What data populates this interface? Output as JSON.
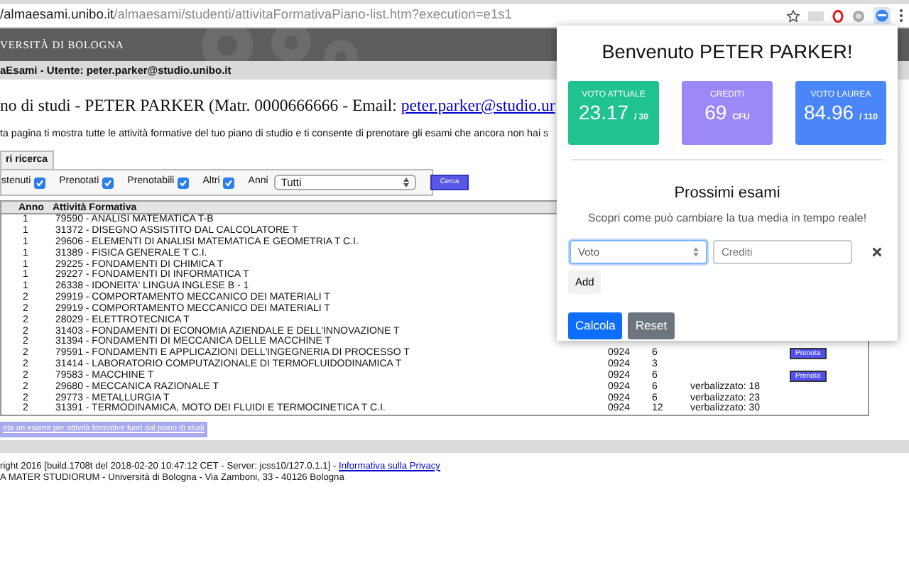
{
  "browser": {
    "url_host": "/almaesami.unibo.it",
    "url_path": "/almaesami/studenti/attivitaFormativaPiano-list.htm?execution=e1s1"
  },
  "banner": {
    "title": "VERSITÀ DI BOLOGNA"
  },
  "user_bar": "aEsami - Utente: peter.parker@studio.unibo.it",
  "heading": {
    "text": "no di studi - PETER PARKER (Matr. 0000666666 - Email: ",
    "link": "peter.parker@studio.ur"
  },
  "description": "ta pagina ti mostra tutte le attività formative del tuo piano di studio e ti consente di prenotare gli esami che ancora non hai s",
  "filter_tab": "ri ricerca",
  "filters": [
    {
      "label": "stenuti",
      "checked": true
    },
    {
      "label": "Prenotati",
      "checked": true
    },
    {
      "label": "Prenotabili",
      "checked": true
    },
    {
      "label": "Altri",
      "checked": true
    }
  ],
  "year_filter": {
    "label": "Anni",
    "value": "Tutti"
  },
  "search_button": "Cerca",
  "table": {
    "columns": [
      "Anno",
      "Attività Formativa"
    ],
    "rows": [
      {
        "anno": "1",
        "activity": "79590 - ANALISI MATEMATICA T-B"
      },
      {
        "anno": "1",
        "activity": "31372 - DISEGNO ASSISTITO DAL CALCOLATORE T"
      },
      {
        "anno": "1",
        "activity": "29606 - ELEMENTI DI ANALISI MATEMATICA E GEOMETRIA T C.I."
      },
      {
        "anno": "1",
        "activity": "31389 - FISICA GENERALE T C.I."
      },
      {
        "anno": "1",
        "activity": "29225 - FONDAMENTI DI CHIMICA T"
      },
      {
        "anno": "1",
        "activity": "29227 - FONDAMENTI DI INFORMATICA T"
      },
      {
        "anno": "1",
        "activity": "26338 - IDONEITA' LINGUA INGLESE B - 1"
      },
      {
        "anno": "2",
        "activity": "29919 - COMPORTAMENTO MECCANICO DEI MATERIALI T"
      },
      {
        "anno": "2",
        "activity": "29919 - COMPORTAMENTO MECCANICO DEI MATERIALI T"
      },
      {
        "anno": "2",
        "activity": "28029 - ELETTROTECNICA T"
      },
      {
        "anno": "2",
        "activity": "31403 - FONDAMENTI DI ECONOMIA AZIENDALE E DELL'INNOVAZIONE T"
      },
      {
        "anno": "2",
        "activity": "31394 - FONDAMENTI DI MECCANICA DELLE MACCHINE T"
      },
      {
        "anno": "2",
        "activity": "79591 - FONDAMENTI E APPLICAZIONI DELL'INGEGNERIA DI PROCESSO T",
        "code": "0924",
        "cfu": "6",
        "action": "Prenota"
      },
      {
        "anno": "2",
        "activity": "31414 - LABORATORIO COMPUTAZIONALE DI TERMOFLUIDODINAMICA T",
        "code": "0924",
        "cfu": "3"
      },
      {
        "anno": "2",
        "activity": "79583 - MACCHINE T",
        "code": "0924",
        "cfu": "6",
        "action": "Prenota"
      },
      {
        "anno": "2",
        "activity": "29680 - MECCANICA RAZIONALE T",
        "code": "0924",
        "cfu": "6",
        "note": "verbalizzato: 18"
      },
      {
        "anno": "2",
        "activity": "29773 - METALLURGIA T",
        "code": "0924",
        "cfu": "6",
        "note": "verbalizzato: 23"
      },
      {
        "anno": "2",
        "activity": "31391 - TERMODINAMICA, MOTO DEI FLUIDI E TERMOCINETICA T C.I.",
        "code": "0924",
        "cfu": "12",
        "note": "verbalizzato: 30"
      }
    ]
  },
  "outside_plan_link": "ota un esame per attività formative fuori dal piano di studi",
  "footer": {
    "line1": "right 2016 [build.1708t del 2018-02-20 10:47:12 CET - Server: jcss10/127.0.1.1] - ",
    "privacy_link": "Informativa sulla Privacy",
    "line2": "A MATER STUDIORUM - Università di Bologna - Via Zamboni, 33 - 40126 Bologna"
  },
  "popup": {
    "title": "Benvenuto PETER PARKER!",
    "stats": [
      {
        "label": "VOTO ATTUALE",
        "value": "23.17",
        "unit": "/ 30",
        "color": "#20c38f"
      },
      {
        "label": "CREDITI",
        "value": "69",
        "unit": "CFU",
        "color": "#9c88f7"
      },
      {
        "label": "VOTO LAUREA",
        "value": "84.96",
        "unit": "/ 110",
        "color": "#4b86f9"
      }
    ],
    "section_title": "Prossimi esami",
    "subtitle": "Scopri come può cambiare la tua media in tempo reale!",
    "grade_select": {
      "value": "Voto",
      "focused": true
    },
    "credits_field": {
      "placeholder": "Crediti"
    },
    "add_button": "Add",
    "buttons": [
      {
        "label": "Calcola",
        "kind": "primary"
      },
      {
        "label": "Reset",
        "kind": "secondary"
      }
    ]
  }
}
